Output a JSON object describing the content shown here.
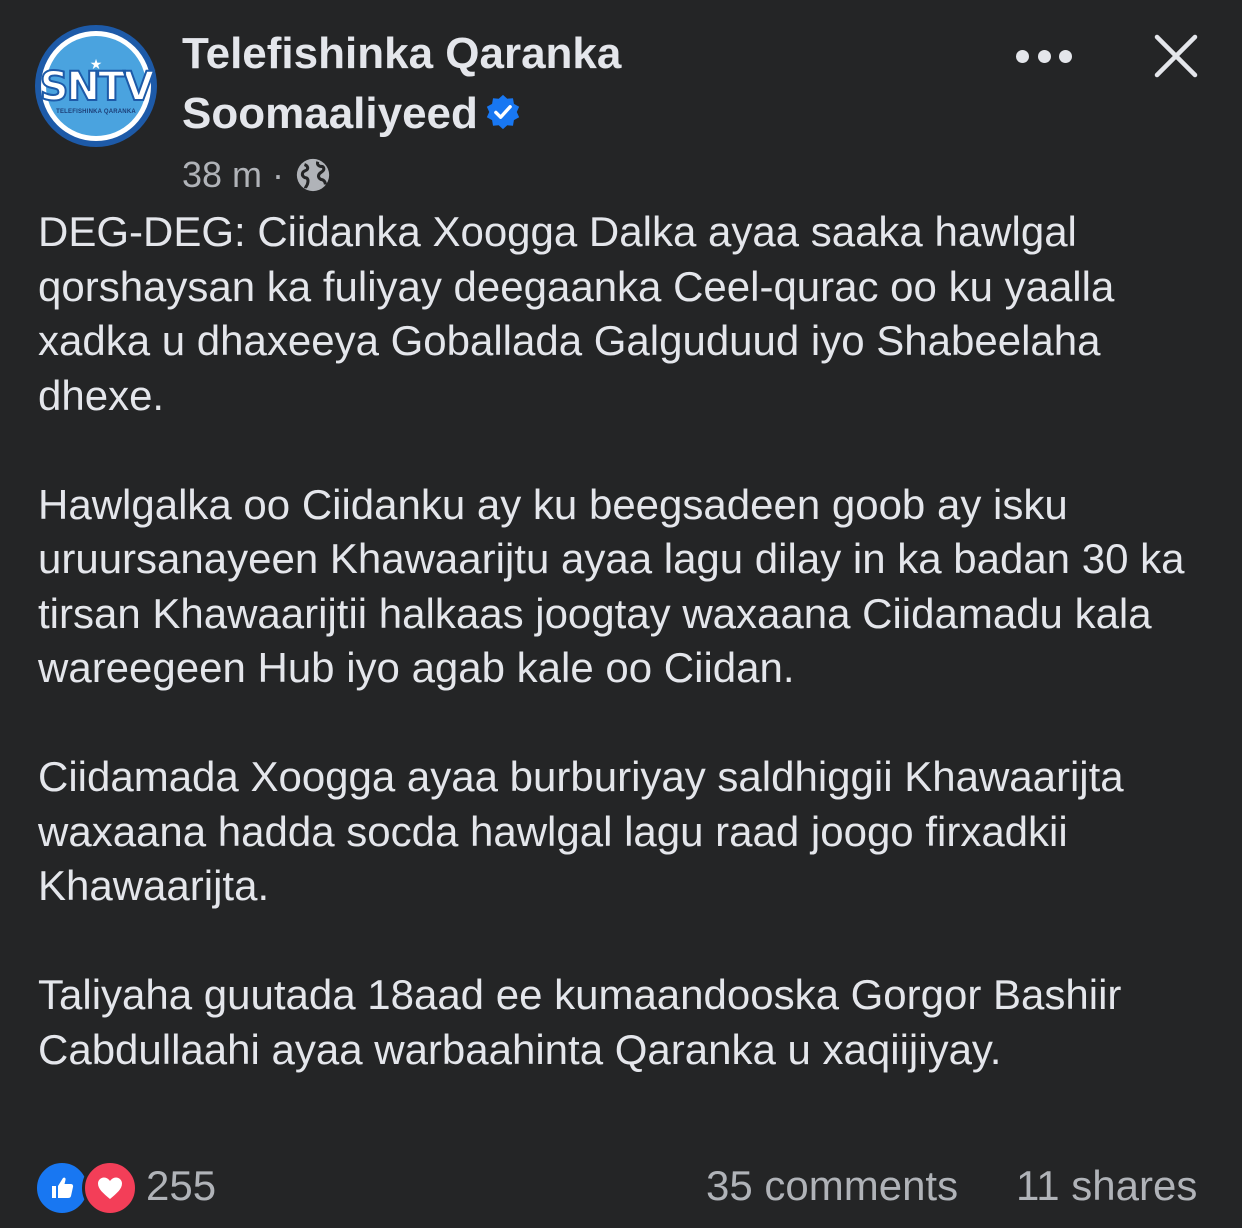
{
  "header": {
    "avatar": {
      "brand": "SNTV",
      "subtitle": "TELEFISHINKA QARANKA"
    },
    "page_name_line1": "Telefishinka Qaranka",
    "page_name_line2": "Soomaaliyeed",
    "verified": true,
    "time": "38 m",
    "separator": "·",
    "audience_icon": "globe-icon",
    "more_icon": "more-icon",
    "close_icon": "close-icon"
  },
  "post": {
    "paragraphs": [
      "DEG-DEG: Ciidanka Xoogga Dalka ayaa saaka hawlgal qorshaysan ka fuliyay deegaanka Ceel-qurac oo ku yaalla xadka u dhaxeeya Goballada Galguduud iyo Shabeelaha dhexe.",
      "Hawlgalka oo Ciidanku ay ku beegsadeen goob ay isku uruursanayeen Khawaarijtu ayaa lagu dilay in ka badan 30 ka tirsan Khawaarijtii halkaas joogtay waxaana Ciidamadu kala wareegeen Hub iyo agab kale oo Ciidan.",
      "Ciidamada Xoogga ayaa burburiyay saldhiggii Khawaarijta waxaana hadda socda hawlgal lagu raad joogo firxadkii Khawaarijta.",
      "Taliyaha guutada 18aad ee kumaandooska Gorgor Bashiir Cabdullaahi ayaa warbaahinta Qaranka u xaqiijiyay."
    ]
  },
  "footer": {
    "reaction_icons": [
      "like-icon",
      "love-icon"
    ],
    "reaction_count": "255",
    "comments": "35 comments",
    "shares": "11 shares"
  },
  "colors": {
    "background": "#242526",
    "text_primary": "#e4e6eb",
    "text_secondary": "#b0b3b8",
    "like_blue": "#1877f2",
    "love_red": "#f33e58",
    "verified_blue": "#1877f2"
  }
}
